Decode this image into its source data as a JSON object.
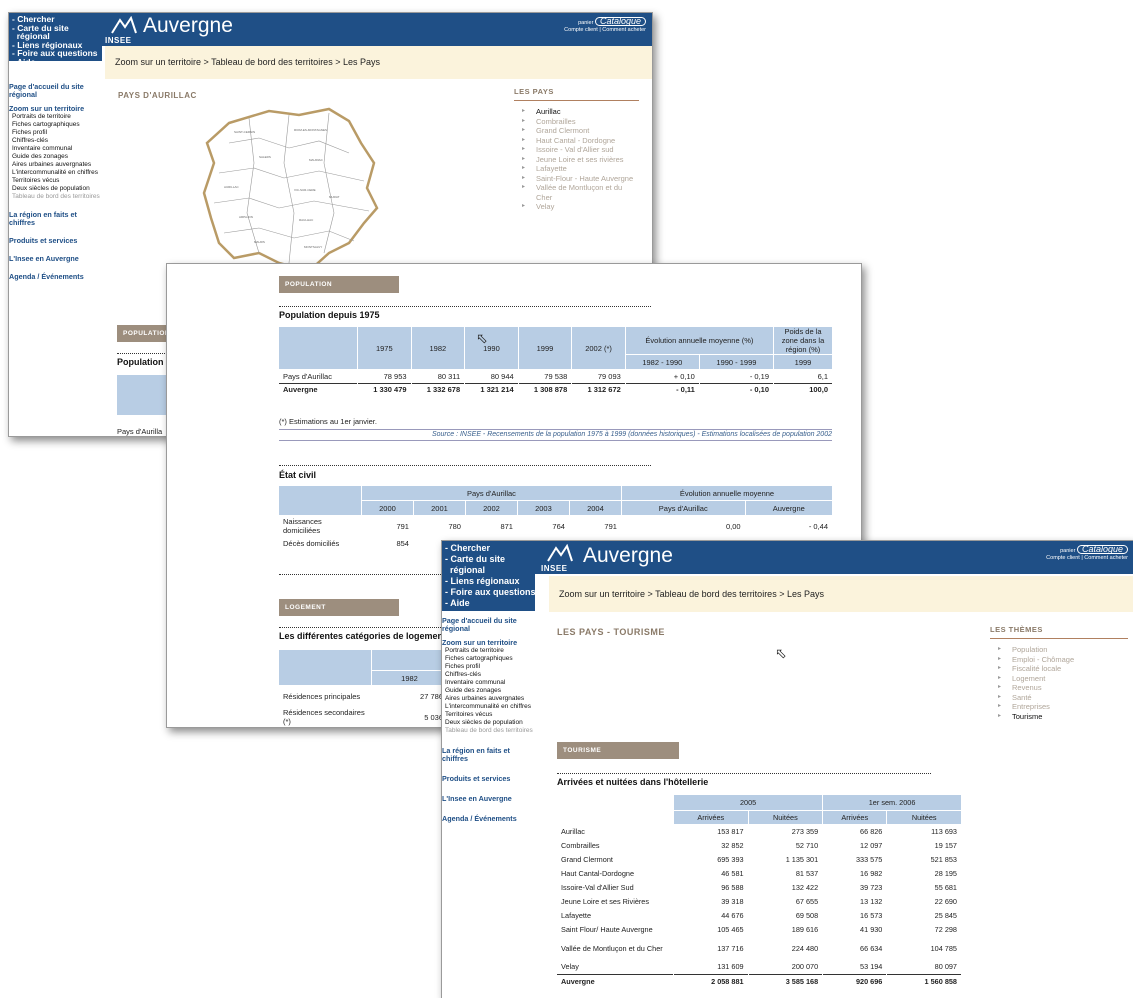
{
  "menu": [
    "Chercher",
    "Carte du site",
    "régional",
    "Liens régionaux",
    "Foire aux questions",
    "Aide"
  ],
  "brand": {
    "title": "Auvergne",
    "logo_text": "INSEE"
  },
  "catalogue": {
    "top": "panier",
    "main": "Catalogue",
    "links": "Compte client | Comment acheter"
  },
  "breadcrumb": "Zoom sur un territoire > Tableau de bord des territoires > Les Pays",
  "leftnav": {
    "home": "Page d'accueil du site régional",
    "zoom": "Zoom sur un territoire",
    "items": [
      "Portraits de territoire",
      "Fiches cartographiques",
      "Fiches profil",
      "Chiffres-clés",
      "Inventaire communal",
      "Guide des zonages",
      "Aires urbaines auvergnates",
      "L'intercommunalité en chiffres",
      "Territoires vécus",
      "Deux siècles de population"
    ],
    "current": "Tableau de bord des territoires",
    "region": "La région en faits et chiffres",
    "products": "Produits et services",
    "insee": "L'Insee en Auvergne",
    "agenda": "Agenda / Événements"
  },
  "win1": {
    "page_title": "PAYS D'AURILLAC",
    "panel_title": "LES PAYS",
    "pays": [
      "Aurillac",
      "Combrailles",
      "Grand Clermont",
      "Haut Cantal - Dordogne",
      "Issoire - Val d'Allier sud",
      "Jeune Loire et ses rivières",
      "Lafayette",
      "Saint-Flour - Haute Auvergne",
      "Vallée de Montluçon et du Cher",
      "Velay"
    ],
    "peek_header": "POPULATION",
    "peek_subtitle": "Population d",
    "peek_row": "Pays d'Aurilla"
  },
  "win2": {
    "section_population": "POPULATION",
    "pop_title": "Population depuis 1975",
    "pop_years": [
      "1975",
      "1982",
      "1990",
      "1999",
      "2002 (*)"
    ],
    "pop_evol_head": "Évolution annuelle moyenne (%)",
    "pop_evol_sub": [
      "1982 - 1990",
      "1990 - 1999"
    ],
    "pop_weight_head": "Poids de la zone dans la région (%)",
    "pop_weight_sub": "1999",
    "pop_rows": [
      {
        "label": "Pays d'Aurillac",
        "v": [
          "78 953",
          "80 311",
          "80 944",
          "79 538",
          "79 093",
          "+ 0,10",
          "- 0,19",
          "6,1"
        ]
      },
      {
        "label": "Auvergne",
        "v": [
          "1 330 479",
          "1 332 678",
          "1 321 214",
          "1 308 878",
          "1 312 672",
          "- 0,11",
          "- 0,10",
          "100,0"
        ]
      }
    ],
    "pop_note": "(*) Estimations au 1er janvier.",
    "pop_source": "Source : INSEE - Recensements de la population 1975 à 1999 (données historiques) - Estimations localisées de population 2002",
    "etat_title": "État civil",
    "etat_head_pays": "Pays d'Aurillac",
    "etat_head_evol": "Évolution annuelle moyenne",
    "etat_years": [
      "2000",
      "2001",
      "2002",
      "2003",
      "2004"
    ],
    "etat_evol_cols": [
      "Pays d'Aurillac",
      "Auvergne"
    ],
    "etat_rows": [
      {
        "label": "Naissances domiciliées",
        "v": [
          "791",
          "780",
          "871",
          "764",
          "791",
          "0,00",
          "- 0,44"
        ]
      },
      {
        "label": "Décès domiciliés",
        "v": [
          "854",
          "",
          "",
          "",
          "",
          "",
          ""
        ]
      }
    ],
    "section_logement": "LOGEMENT",
    "log_title": "Les différentes catégories de logements",
    "log_year": "1982",
    "log_rows": [
      {
        "label": "Résidences principales",
        "v": "27 786"
      },
      {
        "label": "Résidences secondaires (*)",
        "v": "5 036"
      }
    ]
  },
  "win3": {
    "page_title": "LES PAYS - TOURISME",
    "panel_title": "LES THÈMES",
    "themes": [
      "Population",
      "Emploi - Chômage",
      "Fiscalité locale",
      "Logement",
      "Revenus",
      "Santé",
      "Entreprises",
      "Tourisme"
    ],
    "section": "TOURISME",
    "table_title": "Arrivées et nuitées dans l'hôtellerie",
    "periods": [
      "2005",
      "1er sem. 2006"
    ],
    "cols": [
      "Arrivées",
      "Nuitées",
      "Arrivées",
      "Nuitées"
    ],
    "rows": [
      {
        "label": "Aurillac",
        "v": [
          "153 817",
          "273 359",
          "66 826",
          "113 693"
        ]
      },
      {
        "label": "Combrailles",
        "v": [
          "32 852",
          "52 710",
          "12 097",
          "19 157"
        ]
      },
      {
        "label": "Grand Clermont",
        "v": [
          "695 393",
          "1 135 301",
          "333 575",
          "521 853"
        ]
      },
      {
        "label": "Haut Cantal-Dordogne",
        "v": [
          "46 581",
          "81 537",
          "16 982",
          "28 195"
        ]
      },
      {
        "label": "Issoire-Val d'Allier Sud",
        "v": [
          "96 588",
          "132 422",
          "39 723",
          "55 681"
        ]
      },
      {
        "label": "Jeune Loire et ses Rivières",
        "v": [
          "39 318",
          "67 655",
          "13 132",
          "22 690"
        ]
      },
      {
        "label": "Lafayette",
        "v": [
          "44 676",
          "69 508",
          "16 573",
          "25 845"
        ]
      },
      {
        "label": "Saint Flour/ Haute Auvergne",
        "v": [
          "105 465",
          "189 616",
          "41 930",
          "72 298"
        ]
      },
      {
        "label": "Vallée de Montluçon et du Cher",
        "v": [
          "137 716",
          "224 480",
          "66 634",
          "104 785"
        ]
      },
      {
        "label": "Velay",
        "v": [
          "131 609",
          "200 070",
          "53 194",
          "80 097"
        ]
      }
    ],
    "total": {
      "label": "Auvergne",
      "v": [
        "2 058 881",
        "3 585 168",
        "920 696",
        "1 560 858"
      ]
    }
  }
}
